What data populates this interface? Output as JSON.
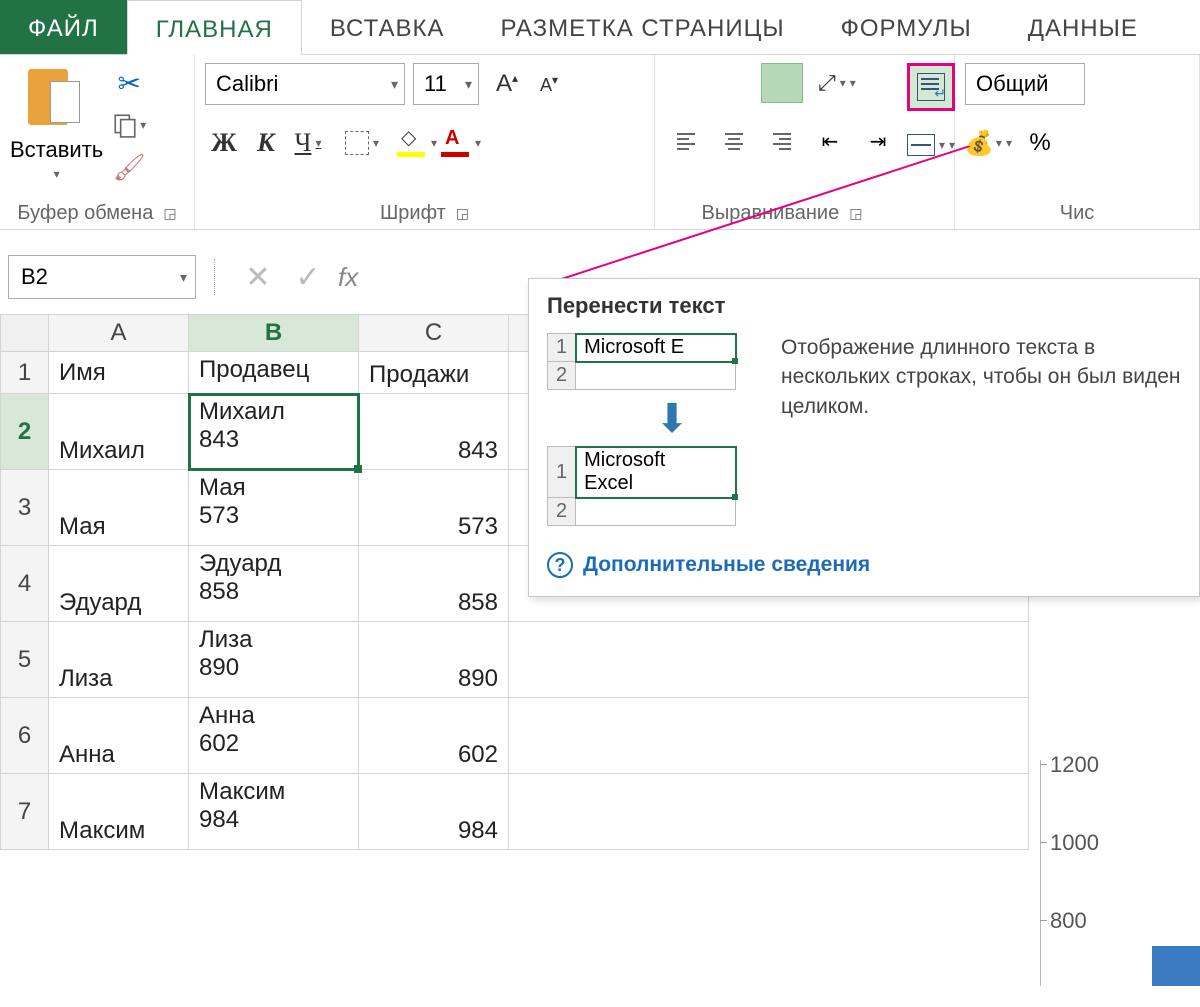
{
  "tabs": {
    "file": "ФАЙЛ",
    "home": "ГЛАВНАЯ",
    "insert": "ВСТАВКА",
    "pagelayout": "РАЗМЕТКА СТРАНИЦЫ",
    "formulas": "ФОРМУЛЫ",
    "data": "ДАННЫЕ"
  },
  "ribbon": {
    "clipboard": {
      "paste": "Вставить",
      "label": "Буфер обмена"
    },
    "font": {
      "name": "Calibri",
      "size": "11",
      "bold": "Ж",
      "italic": "К",
      "underline": "Ч",
      "label": "Шрифт"
    },
    "alignment": {
      "label": "Выравнивание"
    },
    "number": {
      "format": "Общий",
      "percent": "%",
      "label": "Чис"
    }
  },
  "formula_bar": {
    "cell_ref": "B2",
    "fx": "fx"
  },
  "grid": {
    "columns": [
      "A",
      "B",
      "C"
    ],
    "headers": {
      "A": "Имя",
      "B": "Продавец",
      "C": "Продажи"
    },
    "rows": [
      {
        "n": 1
      },
      {
        "n": 2,
        "A": "Михаил",
        "B": "Михаил\n843",
        "C": "843"
      },
      {
        "n": 3,
        "A": "Мая",
        "B": "Мая\n573",
        "C": "573"
      },
      {
        "n": 4,
        "A": "Эдуард",
        "B": "Эдуард\n858",
        "C": "858"
      },
      {
        "n": 5,
        "A": "Лиза",
        "B": "Лиза\n890",
        "C": "890"
      },
      {
        "n": 6,
        "A": "Анна",
        "B": "Анна\n602",
        "C": "602"
      },
      {
        "n": 7,
        "A": "Максим",
        "B": "Максим\n984",
        "C": "984"
      }
    ],
    "selected": "B2"
  },
  "tooltip": {
    "title": "Перенести текст",
    "demo_before": "Microsoft E",
    "demo_after": "Microsoft\nExcel",
    "row1": "1",
    "row2": "2",
    "description": "Отображение длинного текста в нескольких строках, чтобы он был виден целиком.",
    "more": "Дополнительные сведения"
  },
  "chart_axis": {
    "ticks": [
      "1200",
      "1000",
      "800"
    ]
  }
}
